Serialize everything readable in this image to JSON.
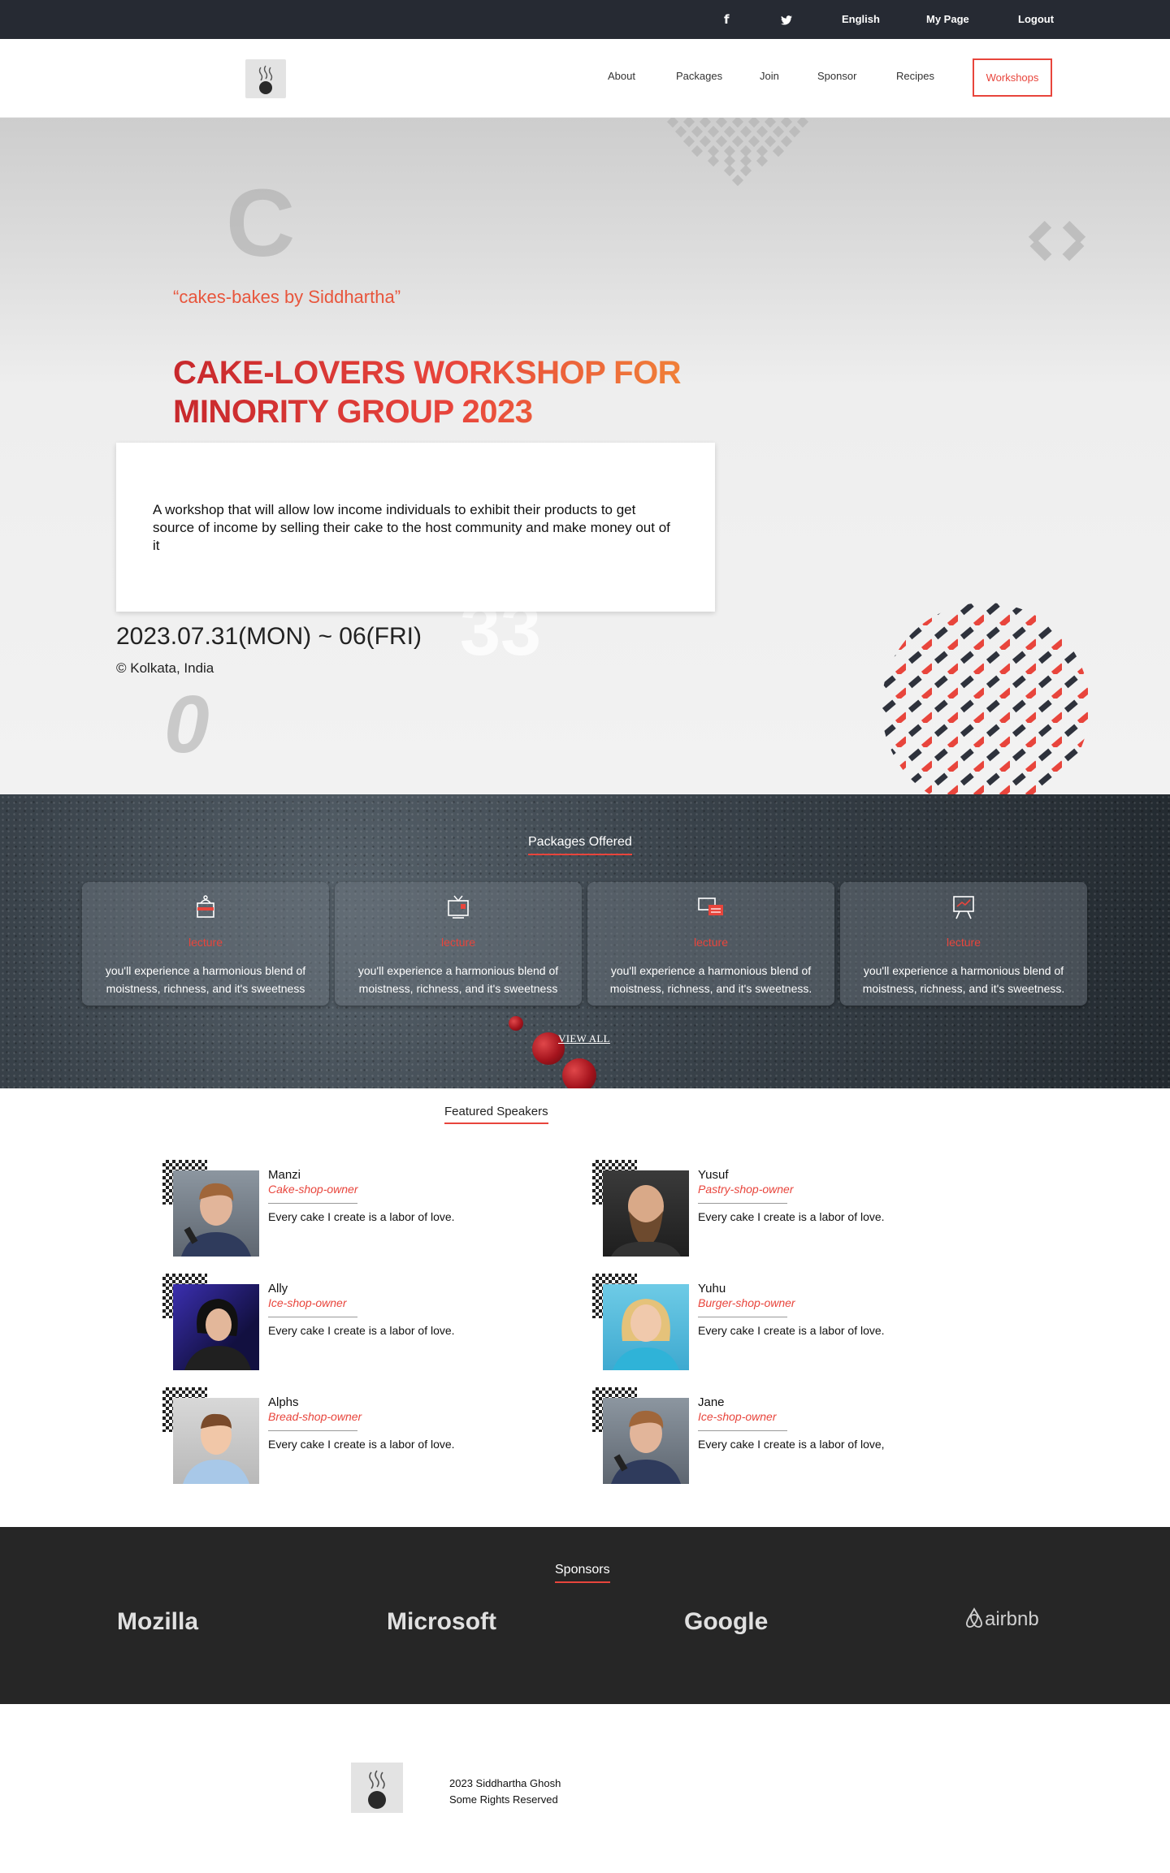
{
  "topbar": {
    "facebook_icon": "facebook-icon",
    "twitter_icon": "twitter-icon",
    "language": "English",
    "my_page": "My Page",
    "logout": "Logout"
  },
  "nav": {
    "items": [
      "About",
      "Packages",
      "Join",
      "Sponsor",
      "Recipes"
    ],
    "workshops": "Workshops",
    "accent": "#e8453c"
  },
  "hero": {
    "quote": "“cakes-bakes by Siddhartha”",
    "title_line1": "CAKE-LOVERS WORKSHOP FOR",
    "title_line2": "MINORITY GROUP 2023",
    "description": "A workshop that will allow low income individuals to exhibit their products to get source of income by selling their cake to the host community and make money out of it",
    "date": "2023.07.31(MON) ~ 06(FRI)",
    "location": "© Kolkata, India",
    "ghost_letter": "C",
    "ghost_number": "0",
    "ghost_digits": "33"
  },
  "packages": {
    "title": "Packages Offered",
    "cards": [
      {
        "icon": "cake-box-icon",
        "label": "lecture",
        "desc": "you'll experience a harmonious blend of moistness, richness, and it's sweetness"
      },
      {
        "icon": "tv-icon",
        "label": "lecture",
        "desc": "you'll experience a harmonious blend of moistness, richness, and it's sweetness"
      },
      {
        "icon": "screens-icon",
        "label": "lecture",
        "desc": "you'll experience a harmonious blend of moistness, richness, and it's sweetness."
      },
      {
        "icon": "presentation-icon",
        "label": "lecture",
        "desc": "you'll experience a harmonious blend of moistness, richness, and it's sweetness."
      }
    ],
    "view_all": "VIEW ALL"
  },
  "speakers": {
    "title": "Featured Speakers",
    "list": [
      {
        "name": "Manzi",
        "role": "Cake-shop-owner",
        "bio": "Every cake I create is a labor of love."
      },
      {
        "name": "Yusuf",
        "role": "Pastry-shop-owner",
        "bio": "Every cake I create is a labor of love."
      },
      {
        "name": "Ally",
        "role": "Ice-shop-owner",
        "bio": "Every cake I create is a labor of love."
      },
      {
        "name": "Yuhu",
        "role": "Burger-shop-owner",
        "bio": "Every cake I create is a labor of love."
      },
      {
        "name": "Alphs",
        "role": "Bread-shop-owner",
        "bio": "Every cake I create is a labor of love."
      },
      {
        "name": "Jane",
        "role": "Ice-shop-owner",
        "bio": "Every cake I create is a labor of love,"
      }
    ]
  },
  "sponsors": {
    "title": "Sponsors",
    "names": [
      "Mozilla",
      "Microsoft",
      "Google",
      "airbnb"
    ]
  },
  "footer": {
    "line1": "2023 Siddhartha Ghosh",
    "line2": "Some Rights Reserved"
  }
}
